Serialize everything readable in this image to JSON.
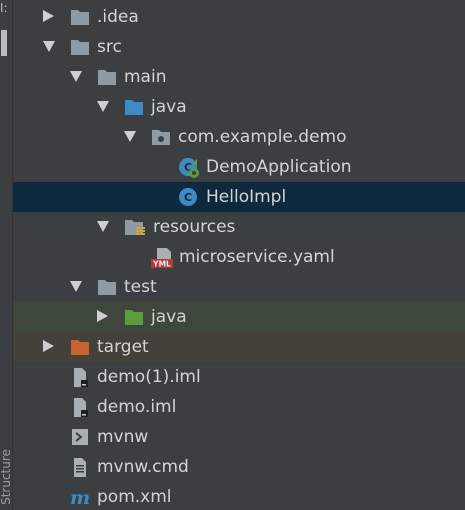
{
  "side_panel": {
    "top_label": "Ⅰ:",
    "bottom_label": "Structure"
  },
  "tree": {
    "items": [
      {
        "label": ".idea",
        "icon": "folder-icon",
        "expanded": false
      },
      {
        "label": "src",
        "icon": "folder-icon",
        "expanded": true
      },
      {
        "label": "main",
        "icon": "folder-icon",
        "expanded": true
      },
      {
        "label": "java",
        "icon": "source-folder-icon",
        "expanded": true
      },
      {
        "label": "com.example.demo",
        "icon": "package-icon",
        "expanded": true
      },
      {
        "label": "DemoApplication",
        "icon": "spring-boot-class-icon"
      },
      {
        "label": "HelloImpl",
        "icon": "class-icon",
        "selected": true
      },
      {
        "label": "resources",
        "icon": "resources-folder-icon",
        "expanded": true
      },
      {
        "label": "microservice.yaml",
        "icon": "yaml-file-icon"
      },
      {
        "label": "test",
        "icon": "folder-icon",
        "expanded": true
      },
      {
        "label": "java",
        "icon": "test-source-folder-icon",
        "expanded": false
      },
      {
        "label": "target",
        "icon": "excluded-folder-icon",
        "expanded": false
      },
      {
        "label": "demo(1).iml",
        "icon": "iml-file-icon"
      },
      {
        "label": "demo.iml",
        "icon": "iml-file-icon"
      },
      {
        "label": "mvnw",
        "icon": "shell-script-icon"
      },
      {
        "label": "mvnw.cmd",
        "icon": "text-file-icon"
      },
      {
        "label": "pom.xml",
        "icon": "maven-icon"
      }
    ]
  },
  "colors": {
    "background": "#3c3f41",
    "selected_row": "#0d293e",
    "test_row": "#3d473b",
    "target_row": "#44403a",
    "text": "#d4d4d4",
    "folder_gray": "#8f9ba4",
    "source_blue": "#3d8bc4",
    "test_green": "#5b9c3c",
    "excluded_orange": "#c7642c"
  }
}
